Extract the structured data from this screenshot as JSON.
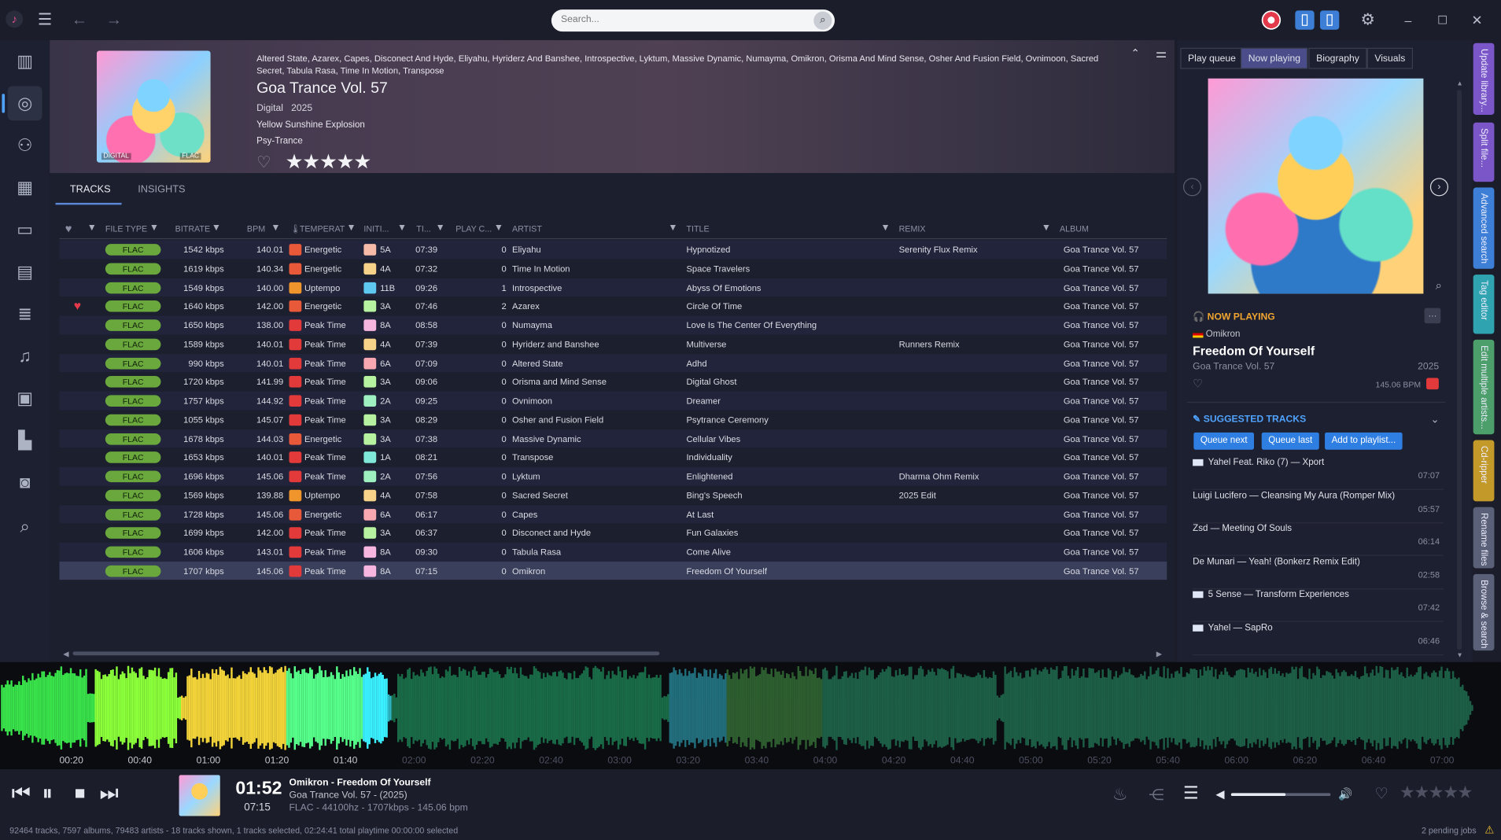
{
  "app": {
    "search_placeholder": "Search..."
  },
  "album": {
    "artists": "Altered State, Azarex, Capes, Disconect And Hyde, Eliyahu, Hyriderz And Banshee, Introspective, Lyktum, Massive Dynamic, Numayma, Omikron, Orisma And Mind Sense, Osher And Fusion Field, Ovnimoon, Sacred Secret, Tabula Rasa, Time In Motion, Transpose",
    "title": "Goa Trance Vol. 57",
    "format": "Digital",
    "year": "2025",
    "label": "Yellow Sunshine Explosion",
    "genre": "Psy-Trance",
    "cover_tag_left": "DIGITAL",
    "cover_tag_right": "FLAC",
    "rating_stars": "★★★★★"
  },
  "tabs": {
    "tracks": "TRACKS",
    "insights": "INSIGHTS"
  },
  "columns": {
    "file_type": "FILE TYPE",
    "bitrate": "BITRATE",
    "bpm": "BPM",
    "temperament": "TEMPERAT",
    "initial_key": "INITI...",
    "time": "TI...",
    "play_count": "PLAY C...",
    "artist": "ARTIST",
    "title": "TITLE",
    "remix": "REMIX",
    "album": "ALBUM"
  },
  "tracks": [
    {
      "type": "FLAC",
      "bitrate": "1542 kbps",
      "bpm": "140.01",
      "temp": "Energetic",
      "temp_color": "#e8593a",
      "key": "5A",
      "key_color": "#f7b9a8",
      "time": "07:39",
      "plays": "0",
      "artist": "Eliyahu",
      "title": "Hypnotized",
      "remix": "Serenity Flux Remix",
      "album": "Goa Trance Vol. 57",
      "fav": false
    },
    {
      "type": "FLAC",
      "bitrate": "1619 kbps",
      "bpm": "140.34",
      "temp": "Energetic",
      "temp_color": "#e8593a",
      "key": "4A",
      "key_color": "#f7d38a",
      "time": "07:32",
      "plays": "0",
      "artist": "Time In Motion",
      "title": "Space Travelers",
      "remix": "",
      "album": "Goa Trance Vol. 57",
      "fav": false
    },
    {
      "type": "FLAC",
      "bitrate": "1549 kbps",
      "bpm": "140.00",
      "temp": "Uptempo",
      "temp_color": "#f0952b",
      "key": "11B",
      "key_color": "#5fc8f0",
      "time": "09:26",
      "plays": "1",
      "artist": "Introspective",
      "title": "Abyss Of Emotions",
      "remix": "",
      "album": "Goa Trance Vol. 57",
      "fav": false
    },
    {
      "type": "FLAC",
      "bitrate": "1640 kbps",
      "bpm": "142.00",
      "temp": "Energetic",
      "temp_color": "#e8593a",
      "key": "3A",
      "key_color": "#b6f2a0",
      "time": "07:46",
      "plays": "2",
      "artist": "Azarex",
      "title": "Circle Of Time",
      "remix": "",
      "album": "Goa Trance Vol. 57",
      "fav": true
    },
    {
      "type": "FLAC",
      "bitrate": "1650 kbps",
      "bpm": "138.00",
      "temp": "Peak Time",
      "temp_color": "#e23a3a",
      "key": "8A",
      "key_color": "#f6b6e0",
      "time": "08:58",
      "plays": "0",
      "artist": "Numayma",
      "title": "Love Is The Center Of Everything",
      "remix": "",
      "album": "Goa Trance Vol. 57",
      "fav": false
    },
    {
      "type": "FLAC",
      "bitrate": "1589 kbps",
      "bpm": "140.01",
      "temp": "Peak Time",
      "temp_color": "#e23a3a",
      "key": "4A",
      "key_color": "#f7d38a",
      "time": "07:39",
      "plays": "0",
      "artist": "Hyriderz and Banshee",
      "title": "Multiverse",
      "remix": "Runners Remix",
      "album": "Goa Trance Vol. 57",
      "fav": false
    },
    {
      "type": "FLAC",
      "bitrate": "990 kbps",
      "bpm": "140.01",
      "temp": "Peak Time",
      "temp_color": "#e23a3a",
      "key": "6A",
      "key_color": "#f7a8b0",
      "time": "07:09",
      "plays": "0",
      "artist": "Altered State",
      "title": "Adhd",
      "remix": "",
      "album": "Goa Trance Vol. 57",
      "fav": false
    },
    {
      "type": "FLAC",
      "bitrate": "1720 kbps",
      "bpm": "141.99",
      "temp": "Peak Time",
      "temp_color": "#e23a3a",
      "key": "3A",
      "key_color": "#b6f2a0",
      "time": "09:06",
      "plays": "0",
      "artist": "Orisma and Mind Sense",
      "title": "Digital Ghost",
      "remix": "",
      "album": "Goa Trance Vol. 57",
      "fav": false
    },
    {
      "type": "FLAC",
      "bitrate": "1757 kbps",
      "bpm": "144.92",
      "temp": "Peak Time",
      "temp_color": "#e23a3a",
      "key": "2A",
      "key_color": "#9ef0c0",
      "time": "09:25",
      "plays": "0",
      "artist": "Ovnimoon",
      "title": "Dreamer",
      "remix": "",
      "album": "Goa Trance Vol. 57",
      "fav": false
    },
    {
      "type": "FLAC",
      "bitrate": "1055 kbps",
      "bpm": "145.07",
      "temp": "Peak Time",
      "temp_color": "#e23a3a",
      "key": "3A",
      "key_color": "#b6f2a0",
      "time": "08:29",
      "plays": "0",
      "artist": "Osher and Fusion Field",
      "title": "Psytrance Ceremony",
      "remix": "",
      "album": "Goa Trance Vol. 57",
      "fav": false
    },
    {
      "type": "FLAC",
      "bitrate": "1678 kbps",
      "bpm": "144.03",
      "temp": "Energetic",
      "temp_color": "#e8593a",
      "key": "3A",
      "key_color": "#b6f2a0",
      "time": "07:38",
      "plays": "0",
      "artist": "Massive Dynamic",
      "title": "Cellular Vibes",
      "remix": "",
      "album": "Goa Trance Vol. 57",
      "fav": false
    },
    {
      "type": "FLAC",
      "bitrate": "1653 kbps",
      "bpm": "140.01",
      "temp": "Peak Time",
      "temp_color": "#e23a3a",
      "key": "1A",
      "key_color": "#7fe8d8",
      "time": "08:21",
      "plays": "0",
      "artist": "Transpose",
      "title": "Individuality",
      "remix": "",
      "album": "Goa Trance Vol. 57",
      "fav": false
    },
    {
      "type": "FLAC",
      "bitrate": "1696 kbps",
      "bpm": "145.06",
      "temp": "Peak Time",
      "temp_color": "#e23a3a",
      "key": "2A",
      "key_color": "#9ef0c0",
      "time": "07:56",
      "plays": "0",
      "artist": "Lyktum",
      "title": "Enlightened",
      "remix": "Dharma Ohm Remix",
      "album": "Goa Trance Vol. 57",
      "fav": false
    },
    {
      "type": "FLAC",
      "bitrate": "1569 kbps",
      "bpm": "139.88",
      "temp": "Uptempo",
      "temp_color": "#f0952b",
      "key": "4A",
      "key_color": "#f7d38a",
      "time": "07:58",
      "plays": "0",
      "artist": "Sacred Secret",
      "title": "Bing's Speech",
      "remix": "2025 Edit",
      "album": "Goa Trance Vol. 57",
      "fav": false
    },
    {
      "type": "FLAC",
      "bitrate": "1728 kbps",
      "bpm": "145.06",
      "temp": "Energetic",
      "temp_color": "#e8593a",
      "key": "6A",
      "key_color": "#f7a8b0",
      "time": "06:17",
      "plays": "0",
      "artist": "Capes",
      "title": "At Last",
      "remix": "",
      "album": "Goa Trance Vol. 57",
      "fav": false
    },
    {
      "type": "FLAC",
      "bitrate": "1699 kbps",
      "bpm": "142.00",
      "temp": "Peak Time",
      "temp_color": "#e23a3a",
      "key": "3A",
      "key_color": "#b6f2a0",
      "time": "06:37",
      "plays": "0",
      "artist": "Disconect and Hyde",
      "title": "Fun Galaxies",
      "remix": "",
      "album": "Goa Trance Vol. 57",
      "fav": false
    },
    {
      "type": "FLAC",
      "bitrate": "1606 kbps",
      "bpm": "143.01",
      "temp": "Peak Time",
      "temp_color": "#e23a3a",
      "key": "8A",
      "key_color": "#f6b6e0",
      "time": "09:30",
      "plays": "0",
      "artist": "Tabula Rasa",
      "title": "Come Alive",
      "remix": "",
      "album": "Goa Trance Vol. 57",
      "fav": false
    },
    {
      "type": "FLAC",
      "bitrate": "1707 kbps",
      "bpm": "145.06",
      "temp": "Peak Time",
      "temp_color": "#e23a3a",
      "key": "8A",
      "key_color": "#f6b6e0",
      "time": "07:15",
      "plays": "0",
      "artist": "Omikron",
      "title": "Freedom Of Yourself",
      "remix": "",
      "album": "Goa Trance Vol. 57",
      "fav": false,
      "selected": true
    }
  ],
  "right_panel": {
    "tabs": [
      "Play queue",
      "Now playing",
      "Biography",
      "Visuals"
    ],
    "now_playing_heading": "NOW PLAYING",
    "np_artist": "Omikron",
    "np_title": "Freedom Of Yourself",
    "np_album": "Goa Trance Vol. 57",
    "np_year": "2025",
    "np_bpm": "145.06 BPM",
    "suggested_heading": "SUGGESTED TRACKS",
    "btn_queue_next": "Queue next",
    "btn_queue_last": "Queue last",
    "btn_add_playlist": "Add to playlist...",
    "suggested": [
      {
        "text": "Yahel Feat. Riko (7) — Xport",
        "time": "07:07",
        "flag": true
      },
      {
        "text": "Luigi Lucifero — Cleansing My Aura (Romper Mix)",
        "time": "05:57",
        "flag": false
      },
      {
        "text": "Zsd — Meeting Of Souls",
        "time": "06:14",
        "flag": false
      },
      {
        "text": "De Munari — Yeah! (Bonkerz Remix Edit)",
        "time": "02:58",
        "flag": false
      },
      {
        "text": "5 Sense — Transform Experiences",
        "time": "07:42",
        "flag": true
      },
      {
        "text": "Yahel — SapRo",
        "time": "06:46",
        "flag": true
      }
    ]
  },
  "side_tabs": [
    {
      "label": "Update library...",
      "color": "#7a56c9"
    },
    {
      "label": "Split file...",
      "color": "#7a56c9"
    },
    {
      "label": "Advanced search",
      "color": "#3d7fd6"
    },
    {
      "label": "Tag editor",
      "color": "#2fa3b0"
    },
    {
      "label": "Edit multiple artists...",
      "color": "#4c9e6a"
    },
    {
      "label": "Cd-ripper",
      "color": "#c39a2a"
    },
    {
      "label": "Rename files",
      "color": "#5a6078"
    },
    {
      "label": "Browse & search",
      "color": "#5a6078"
    }
  ],
  "timeline": [
    "00:20",
    "00:40",
    "01:00",
    "01:20",
    "01:40",
    "02:00",
    "02:20",
    "02:40",
    "03:00",
    "03:20",
    "03:40",
    "04:00",
    "04:20",
    "04:40",
    "05:00",
    "05:20",
    "05:40",
    "06:00",
    "06:20",
    "06:40",
    "07:00"
  ],
  "player": {
    "current_time": "01:52",
    "total_time": "07:15",
    "track_line": "Omikron - Freedom Of Yourself",
    "album_line": "Goa Trance Vol. 57 - (2025)",
    "format_line": "FLAC - 44100hz - 1707kbps - 145.06 bpm",
    "volume": 0.55,
    "progress": 0.258
  },
  "status": {
    "left": "92464 tracks, 7597 albums, 79483 artists - 18 tracks shown, 1 tracks selected, 02:24:41 total playtime 00:00:00 selected",
    "right": "2 pending jobs"
  }
}
